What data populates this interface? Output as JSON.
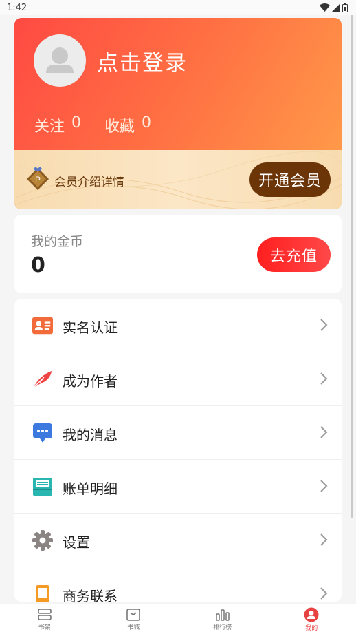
{
  "status_bar": {
    "time": "1:42"
  },
  "profile": {
    "login_text": "点击登录",
    "follow_label": "关注",
    "follow_count": "0",
    "favorite_label": "收藏",
    "favorite_count": "0"
  },
  "vip": {
    "badge_letter": "P",
    "intro_text": "会员介绍详情",
    "button_label": "开通会员"
  },
  "coins": {
    "label": "我的金币",
    "value": "0",
    "recharge_label": "去充值"
  },
  "menu": {
    "items": [
      {
        "label": "实名认证",
        "icon": "id-card-icon"
      },
      {
        "label": "成为作者",
        "icon": "feather-icon"
      },
      {
        "label": "我的消息",
        "icon": "message-icon"
      },
      {
        "label": "账单明细",
        "icon": "bill-icon"
      },
      {
        "label": "设置",
        "icon": "gear-icon"
      },
      {
        "label": "商务联系",
        "icon": "business-icon"
      }
    ]
  },
  "tabs": [
    {
      "label": "书架",
      "icon": "bookshelf-icon"
    },
    {
      "label": "书城",
      "icon": "bookstore-icon"
    },
    {
      "label": "排行榜",
      "icon": "ranking-icon"
    },
    {
      "label": "我的",
      "icon": "profile-icon",
      "active": true
    }
  ],
  "colors": {
    "accent": "#e84141",
    "vip_button": "#6b3508",
    "recharge": "#ff2a2a",
    "gradient_start": "#ff4a43",
    "gradient_end": "#ffa04a"
  }
}
